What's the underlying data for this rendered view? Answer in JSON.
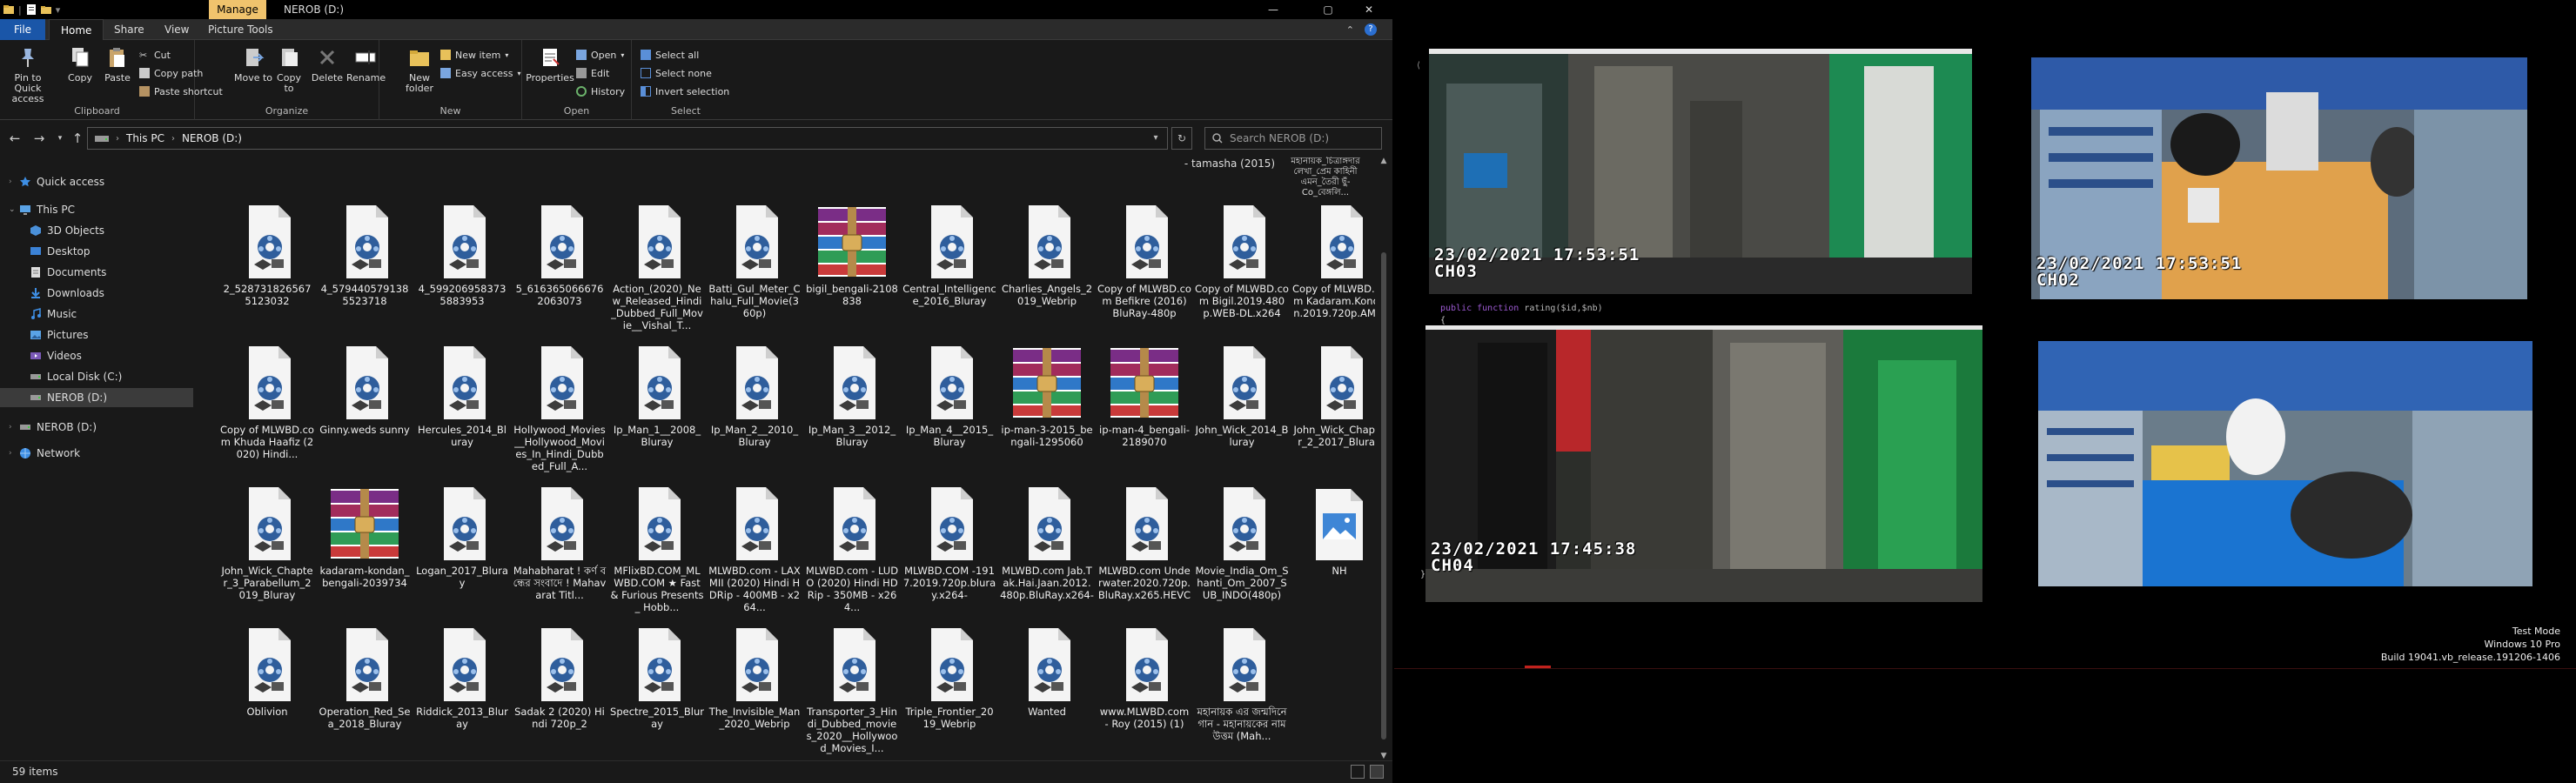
{
  "explorer": {
    "manage_label": "Manage",
    "window_title": "NEROB (D:)",
    "window_controls": {
      "minimize": "—",
      "maximize": "▢",
      "close": "✕"
    },
    "tabs": [
      "File",
      "Home",
      "Share",
      "View",
      "Picture Tools"
    ],
    "ribbon": {
      "clipboard": {
        "pin": "Pin to Quick access",
        "copy": "Copy",
        "paste": "Paste",
        "cut": "Cut",
        "copy_path": "Copy path",
        "paste_shortcut": "Paste shortcut",
        "label": "Clipboard"
      },
      "organize": {
        "move_to": "Move to",
        "copy_to": "Copy to",
        "delete": "Delete",
        "rename": "Rename",
        "label": "Organize"
      },
      "new": {
        "new_folder": "New folder",
        "new_item": "New item",
        "easy_access": "Easy access",
        "label": "New"
      },
      "open": {
        "properties": "Properties",
        "open": "Open",
        "edit": "Edit",
        "history": "History",
        "label": "Open"
      },
      "select": {
        "select_all": "Select all",
        "select_none": "Select none",
        "invert_selection": "Invert selection",
        "label": "Select"
      }
    },
    "address": {
      "this_pc": "This PC",
      "drive": "NEROB (D:)"
    },
    "search_placeholder": "Search NEROB (D:)",
    "nav": {
      "quick_access": "Quick access",
      "this_pc": "This PC",
      "objects_3d": "3D Objects",
      "desktop": "Desktop",
      "documents": "Documents",
      "downloads": "Downloads",
      "music": "Music",
      "pictures": "Pictures",
      "videos": "Videos",
      "local_disk": "Local Disk (C:)",
      "nerob_1": "NEROB (D:)",
      "nerob_2": "NEROB (D:)",
      "network": "Network"
    },
    "top_partial": {
      "tamasha": "- tamasha (2015)",
      "bengali": "মহানায়ক_চিত্রাঙ্গদার লেখা_প্রেম কাহিনী এমন_তৈরী ছুঁ- Co_বেঙ্গলি..."
    },
    "files": [
      {
        "name": "2_5287318265675123032",
        "type": "video"
      },
      {
        "name": "4_5794405791385523718",
        "type": "video"
      },
      {
        "name": "4_5992069583735883953",
        "type": "video"
      },
      {
        "name": "5_6163650666762063073",
        "type": "video"
      },
      {
        "name": "Action_(2020)_New_Released_Hindi_Dubbed_Full_Movie__Vishal_T...",
        "type": "video"
      },
      {
        "name": "Batti_Gul_Meter_Chalu_Full_Movie(360p)",
        "type": "video"
      },
      {
        "name": "bigil_bengali-2108838",
        "type": "archive"
      },
      {
        "name": "Central_Intelligence_2016_Bluray",
        "type": "video"
      },
      {
        "name": "Charlies_Angels_2019_Webrip",
        "type": "video"
      },
      {
        "name": "Copy of MLWBD.com Befikre (2016) BluRay-480p",
        "type": "video"
      },
      {
        "name": "Copy of MLWBD.com Bigil.2019.480p.WEB-DL.x264",
        "type": "video"
      },
      {
        "name": "Copy of MLWBD.com Kadaram.Kondan.2019.720p.AM...",
        "type": "video"
      },
      {
        "name": "Copy of MLWBD.com Khuda Haafiz (2020) Hindi...",
        "type": "video"
      },
      {
        "name": "Ginny.weds sunny",
        "type": "video"
      },
      {
        "name": "Hercules_2014_Bluray",
        "type": "video"
      },
      {
        "name": "Hollywood_Movies__Hollywood_Movies_In_Hindi_Dubbed_Full_A...",
        "type": "video"
      },
      {
        "name": "Ip_Man_1__2008_Bluray",
        "type": "video"
      },
      {
        "name": "Ip_Man_2__2010_Bluray",
        "type": "video"
      },
      {
        "name": "Ip_Man_3__2012_Bluray",
        "type": "video"
      },
      {
        "name": "Ip_Man_4__2015_Bluray",
        "type": "video"
      },
      {
        "name": "ip-man-3-2015_bengali-1295060",
        "type": "archive"
      },
      {
        "name": "ip-man-4_bengali-2189070",
        "type": "archive"
      },
      {
        "name": "John_Wick_2014_Bluray",
        "type": "video"
      },
      {
        "name": "John_Wick_Chapter_2_2017_Bluray",
        "type": "video"
      },
      {
        "name": "John_Wick_Chapter_3_Parabellum_2019_Bluray",
        "type": "video"
      },
      {
        "name": "kadaram-kondan_bengali-2039734",
        "type": "archive"
      },
      {
        "name": "Logan_2017_Bluray",
        "type": "video"
      },
      {
        "name": "Mahabharat ! কৰ্ণ বন্ধের সংবাদে ! Mahavarat Titl...",
        "type": "video"
      },
      {
        "name": "MFlixBD.COM_MLWBD.COM ★ Fast & Furious Presents_ Hobb...",
        "type": "video"
      },
      {
        "name": "MLWBD.com - LAXMII (2020) Hindi HDRip - 400MB - x264...",
        "type": "video"
      },
      {
        "name": "MLWBD.com - LUDO (2020) Hindi HDRip - 350MB - x264...",
        "type": "video"
      },
      {
        "name": "MLWBD.COM -1917.2019.720p.bluray.x264-",
        "type": "video"
      },
      {
        "name": "MLWBD.com Jab.Tak.Hai.Jaan.2012.480p.BluRay.x264-",
        "type": "video"
      },
      {
        "name": "MLWBD.com Underwater.2020.720p.BluRay.x265.HEVC",
        "type": "video"
      },
      {
        "name": "Movie_India_Om_Shanti_Om_2007_SUB_INDO(480p)",
        "type": "video"
      },
      {
        "name": "NH",
        "type": "image"
      },
      {
        "name": "Oblivion",
        "type": "video"
      },
      {
        "name": "Operation_Red_Sea_2018_Bluray",
        "type": "video"
      },
      {
        "name": "Riddick_2013_Bluray",
        "type": "video"
      },
      {
        "name": "Sadak 2 (2020) Hindi 720p_2",
        "type": "video"
      },
      {
        "name": "Spectre_2015_Bluray",
        "type": "video"
      },
      {
        "name": "The_Invisible_Man_2020_Webrip",
        "type": "video"
      },
      {
        "name": "Transporter_3_Hindi_Dubbed_movies_2020__Hollywood_Movies_I...",
        "type": "video"
      },
      {
        "name": "Triple_Frontier_2019_Webrip",
        "type": "video"
      },
      {
        "name": "Wanted",
        "type": "video"
      },
      {
        "name": "www.MLWBD.com - Roy (2015) (1)",
        "type": "video"
      },
      {
        "name": "মহানায়ক এর জন্মদিনে গান - মহানায়কের নাম উত্তম (Mah...",
        "type": "video"
      }
    ],
    "status": "59 items"
  },
  "cctv": {
    "cam1": "23/02/2021 17:53:51\nCH03",
    "cam2": "23/02/2021 17:53:51\nCH02",
    "cam3": "23/02/2021 17:45:38\nCH04",
    "cam4": ""
  },
  "code": {
    "keyword": "public function",
    "rest": " rating($id,$nb)",
    "brace_open": "{",
    "brace_close": "}"
  },
  "watermark": {
    "line1": "Test Mode",
    "line2": "Windows 10 Pro",
    "line3": "Build 19041.vb_release.191206-1406"
  },
  "colors": {
    "accent": "#1a56a8",
    "manage": "#f0c36d",
    "explorer_bg": "#191919"
  }
}
